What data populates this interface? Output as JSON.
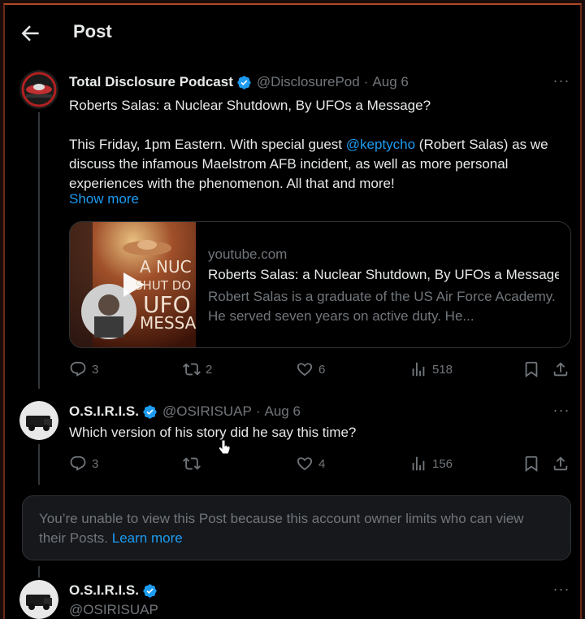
{
  "header": {
    "title": "Post"
  },
  "post1": {
    "display_name": "Total Disclosure Podcast",
    "handle": "@DisclosurePod",
    "separator": "·",
    "date": "Aug 6",
    "title_line": "Roberts Salas: a Nuclear Shutdown, By UFOs a Message?",
    "body_before_mention": "This Friday, 1pm Eastern. With special guest ",
    "mention": "@keptycho",
    "body_after_mention": " (Robert Salas) as we discuss the infamous Maelstrom AFB incident, as well as more personal experiences with the phenomenon. All that and more!",
    "show_more": "Show more",
    "card": {
      "domain": "youtube.com",
      "title": "Roberts Salas: a Nuclear Shutdown, By UFOs a Message?",
      "description": "Robert Salas is a graduate of the US Air Force Academy. He served seven years on active duty. He...",
      "thumb_text_lines": [
        "A NUC",
        "SHUT DO",
        "UFO",
        "MESSA"
      ]
    },
    "replies": "3",
    "reposts": "2",
    "likes": "6",
    "views": "518"
  },
  "post2": {
    "display_name": "O.S.I.R.I.S.",
    "handle": "@OSIRISUAP",
    "separator": "·",
    "date": "Aug 6",
    "text": "Which version of his story did he say this time?",
    "replies": "3",
    "reposts": "",
    "likes": "4",
    "views": "156"
  },
  "restricted": {
    "message": "You’re unable to view this Post because this account owner limits who can view their Posts. ",
    "learn_more": "Learn more"
  },
  "post3": {
    "display_name": "O.S.I.R.I.S.",
    "handle": "@OSIRISUAP"
  },
  "colors": {
    "background": "#000000",
    "accent": "#1d9bf0",
    "muted": "#71767b",
    "text": "#e7e9ea"
  }
}
